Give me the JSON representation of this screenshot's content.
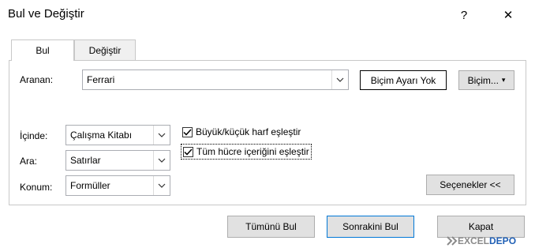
{
  "window": {
    "title": "Bul ve Değiştir",
    "help": "?",
    "close": "✕"
  },
  "tabs": [
    {
      "label": "Bul"
    },
    {
      "label": "Değiştir"
    }
  ],
  "find": {
    "label": "Aranan:",
    "value": "Ferrari",
    "format_preview": "Biçim Ayarı Yok",
    "format_button": "Biçim...",
    "format_arrow": "▾"
  },
  "options": {
    "within": {
      "label": "İçinde:",
      "value": "Çalışma Kitabı"
    },
    "search": {
      "label": "Ara:",
      "value": "Satırlar"
    },
    "look_in": {
      "label": "Konum:",
      "value": "Formüller"
    },
    "match_case": {
      "label": "Büyük/küçük harf eşleştir",
      "checked": true
    },
    "match_entire": {
      "label": "Tüm hücre içeriğini eşleştir",
      "checked": true
    },
    "toggle_button": "Seçenekler <<"
  },
  "footer": {
    "find_all": "Tümünü Bul",
    "find_next": "Sonrakini Bul",
    "close": "Kapat"
  },
  "watermark": {
    "text_left": "EXCEL",
    "text_right": "DEPO"
  },
  "icons": {
    "dropdown": "chevron-down-icon",
    "check": "checkmark-icon"
  },
  "colors": {
    "accent_border": "#0078d7",
    "button_bg": "#e1e1e1",
    "watermark_blue": "#1f5fb5",
    "watermark_grey": "#8a8a8a"
  }
}
